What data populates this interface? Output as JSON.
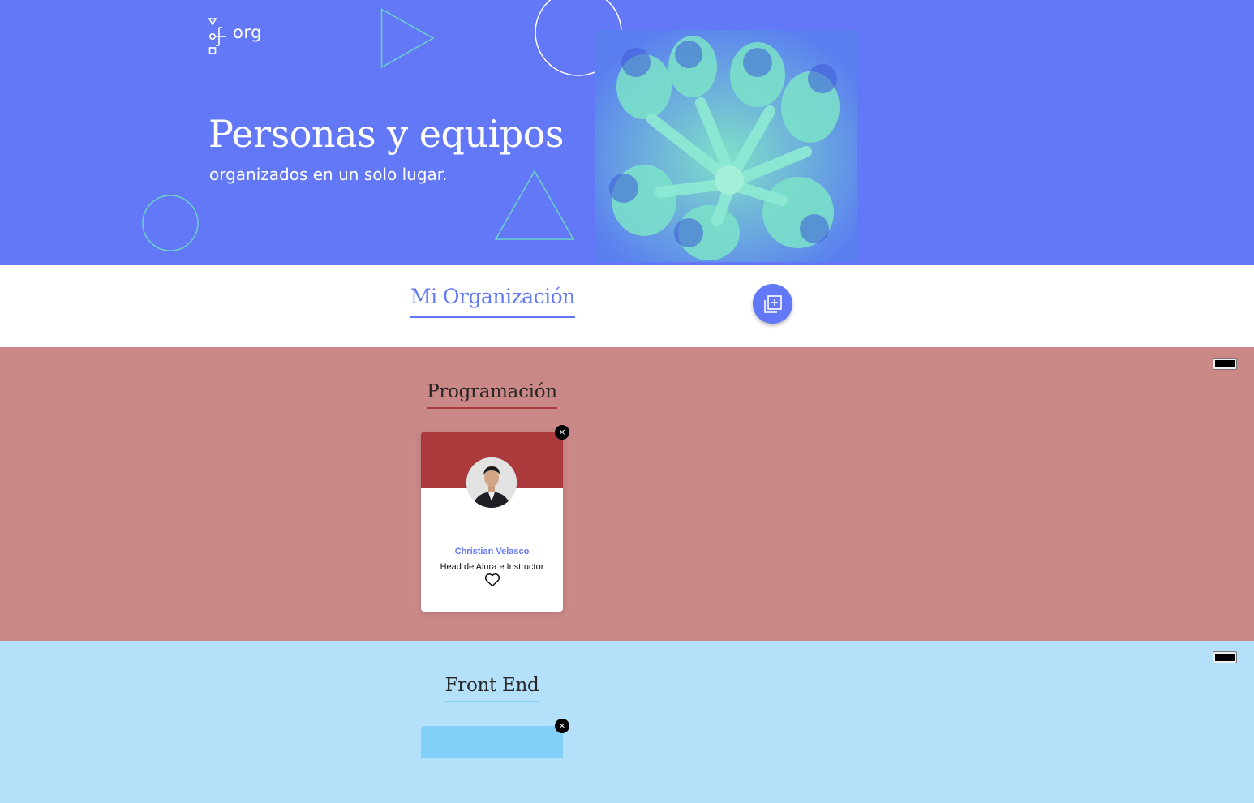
{
  "hero": {
    "logo_text": "org",
    "title": "Personas y equipos",
    "subtitle": "organizados en un solo lugar."
  },
  "organization": {
    "title": "Mi Organización"
  },
  "teams": [
    {
      "title": "Programación",
      "primary_color": "#AA3A3B",
      "secondary_color": "#CA8886",
      "members": [
        {
          "name": "Christian Velasco",
          "role": "Head de Alura e Instructor"
        }
      ]
    },
    {
      "title": "Front End",
      "primary_color": "#82CFFA",
      "secondary_color": "#B4E0F9",
      "members": []
    }
  ],
  "colors": {
    "hero_bg": "#6278F7",
    "accent_green": "#6BD1C6"
  },
  "icons": {
    "add_team": "add-copy-icon",
    "delete": "close-icon",
    "like": "heart-outline-icon"
  },
  "delete_glyph": "×"
}
